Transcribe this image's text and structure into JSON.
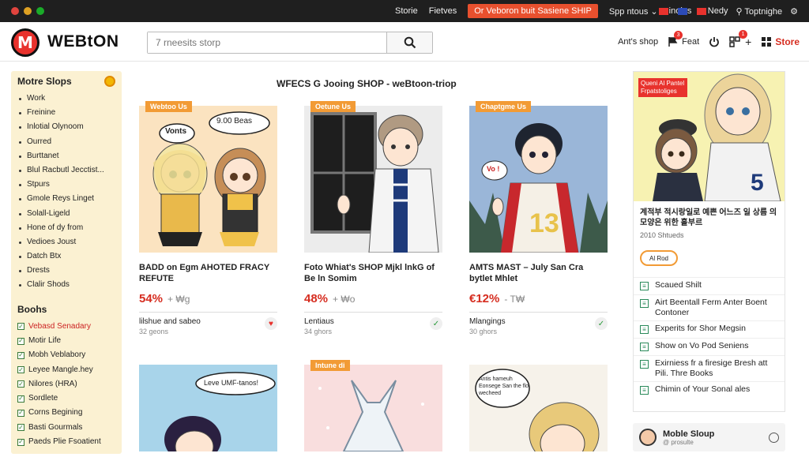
{
  "topbar": {
    "links": [
      "Storie",
      "Fietves"
    ],
    "promo": "Or Veboron buit Sasiene SHIP",
    "right_items": [
      "Spp ntous",
      "inoles",
      "Nedy",
      "Toptnighe"
    ]
  },
  "header": {
    "logo_mark": "M",
    "logo_text": "WEBtON",
    "search_placeholder": "7 rneesits storp",
    "right": {
      "shop_label": "Ant's shop",
      "feat_label": "Feat",
      "feat_badge": "3",
      "cart_badge": "1",
      "store_label": "Store"
    }
  },
  "sidebar": {
    "title": "Motre Slops",
    "items": [
      "Work",
      "Freinine",
      "Inlotial Olynoom",
      "Ourred",
      "Burttanet",
      "Blul Racbutl Jecctist...",
      "Stpurs",
      "Gmole Reys Linget",
      "Solall-Ligeld",
      "Hone of dy from",
      "Vedioes Joust",
      "Datch Btx",
      "Drests",
      "Clalir Shods"
    ],
    "books_title": "Boohs",
    "books": [
      "Vebasd Senadary",
      "Motir Life",
      "Mobh Veblabory",
      "Leyee Mangle.hey",
      "Nilores (HRA)",
      "Sordlete",
      "Corns Begining",
      "Basti Gourmals",
      "Paeds Plie Fsoatient"
    ]
  },
  "main": {
    "title": "WFECS G Jooing SHOP - weBtoon-triop",
    "cards": [
      {
        "tag": "Webtoo Us",
        "title": "BADD on Egm AHOTED FRACY REFUTE",
        "discount": "54%",
        "price_suffix": "+ ₩g",
        "meta": "lilshue and sabeo",
        "sub": "32 geons",
        "status": "heart",
        "bubble": "9.00 Beas",
        "bubble2": "Vonts"
      },
      {
        "tag": "Oetune Us",
        "title": "Foto Whiat's SHOP Mjkl lnkG of Be ln Somim",
        "discount": "48%",
        "price_suffix": "+ ₩o",
        "meta": "Lentiaus",
        "sub": "34 ghors",
        "status": "check"
      },
      {
        "tag": "Chaptgme Us",
        "title": "AMTS MAST – July San Cra bytlet Mhlet",
        "discount": "€12%",
        "price_suffix": "- T₩",
        "meta": "Mlangings",
        "sub": "30 ghors",
        "status": "check",
        "bubble": "Vo !"
      },
      {
        "tag": "",
        "bubble": "Leve UMF-tanos!"
      },
      {
        "tag": "Intune di"
      },
      {
        "tag": "",
        "bubble": "Antis hameuh Eonsege San the flo wecheed"
      }
    ]
  },
  "right_sidebar": {
    "promo": "Queni Al Pantel Frpatstoliges",
    "text": "계적부 적시랑일로 예쁜 어느즈 일 상름 의 모양은 위한 흘부르",
    "sub": "2010 Shtueds",
    "pill": "Al Rod",
    "links": [
      "Scaued Shilt",
      "Airt Beentall Ferm Anter Boent Contoner",
      "Experits for Shor Megsin",
      "Show on Vo Pod Seniens",
      "Exirniess fr a firesige Bresh att Pili. Thre Books",
      "Chimin of Your Sonal ales"
    ]
  },
  "mobile": {
    "title": "Moble Sloup",
    "sub": "@ prosulte"
  },
  "colors": {
    "accent": "#d62d20",
    "tag": "#f29b35",
    "sidebar_bg": "#fbf1d2",
    "topbar": "#1f1f1f"
  }
}
